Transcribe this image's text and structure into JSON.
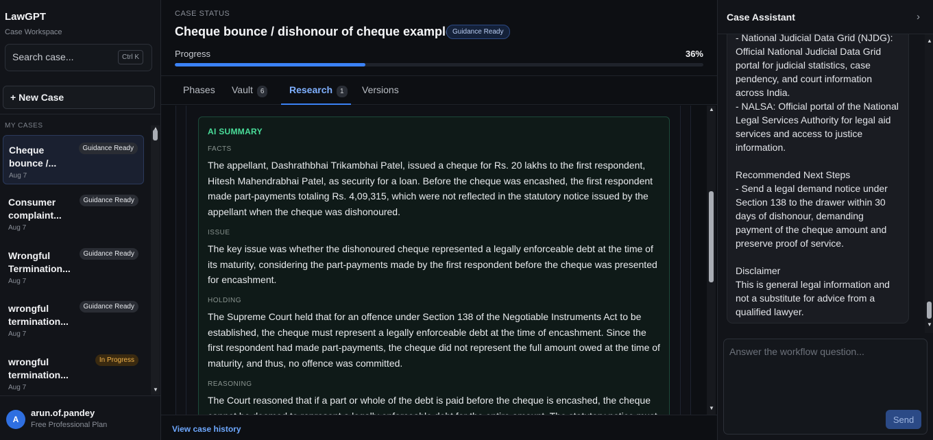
{
  "sidebar": {
    "brand": "LawGPT",
    "brand_sub": "Case Workspace",
    "search_placeholder": "Search case...",
    "search_shortcut": "Ctrl K",
    "new_case_label": "+ New Case",
    "section_label": "MY CASES",
    "cases": [
      {
        "title": "Cheque bounce /...",
        "date": "Aug 7",
        "status": "Guidance Ready"
      },
      {
        "title": "Consumer complaint...",
        "date": "Aug 7",
        "status": "Guidance Ready"
      },
      {
        "title": "Wrongful Termination...",
        "date": "Aug 7",
        "status": "Guidance Ready"
      },
      {
        "title": "wrongful termination...",
        "date": "Aug 7",
        "status": "Guidance Ready"
      },
      {
        "title": "wrongful termination...",
        "date": "Aug 7",
        "status": "In Progress"
      }
    ],
    "user": {
      "initial": "A",
      "name": "arun.of.pandey",
      "plan": "Free Professional Plan"
    }
  },
  "main": {
    "case_status_label": "CASE STATUS",
    "case_title": "Cheque bounce / dishonour of cheque example",
    "case_badge": "Guidance Ready",
    "progress_label": "Progress",
    "progress_percent": "36%",
    "progress_fraction": 0.36,
    "tabs": [
      {
        "label": "Phases",
        "count": ""
      },
      {
        "label": "Vault",
        "count": "6"
      },
      {
        "label": "Research",
        "count": "1"
      },
      {
        "label": "Versions",
        "count": ""
      }
    ],
    "active_tab": "Research",
    "summary": {
      "title": "AI SUMMARY",
      "facts_label": "FACTS",
      "facts_text": "The appellant, Dashrathbhai Trikambhai Patel, issued a cheque for Rs. 20 lakhs to the first respondent, Hitesh Mahendrabhai Patel, as security for a loan. Before the cheque was encashed, the first respondent made part-payments totaling Rs. 4,09,315, which were not reflected in the statutory notice issued by the appellant when the cheque was dishonoured.",
      "issue_label": "ISSUE",
      "issue_text": "The key issue was whether the dishonoured cheque represented a legally enforceable debt at the time of its maturity, considering the part-payments made by the first respondent before the cheque was presented for encashment.",
      "holding_label": "HOLDING",
      "holding_text": "The Supreme Court held that for an offence under Section 138 of the Negotiable Instruments Act to be established, the cheque must represent a legally enforceable debt at the time of encashment. Since the first respondent had made part-payments, the cheque did not represent the full amount owed at the time of maturity, and thus, no offence was committed.",
      "reasoning_label": "REASONING",
      "reasoning_text": "The Court reasoned that if a part or whole of the debt is paid before the cheque is encashed, the cheque cannot be deemed to represent a legally enforceable debt for the entire amount. The statutory notice must"
    },
    "history_link": "View case history"
  },
  "assistant": {
    "title": "Case Assistant",
    "message_lines": [
      "- National Judicial Data Grid (NJDG):",
      "Official National Judicial Data Grid",
      "portal for judicial statistics, case",
      "pendency, and court information",
      "across India.",
      "- NALSA: Official portal of the National",
      "Legal Services Authority for legal aid",
      "services and access to justice",
      "information.",
      "",
      "Recommended Next Steps",
      "- Send a legal demand notice under",
      "Section 138 to the drawer within 30",
      "days of dishonour, demanding",
      "payment of the cheque amount and",
      "preserve proof of service.",
      "",
      "Disclaimer",
      "This is general legal information and",
      "not a substitute for advice from a",
      "qualified lawyer."
    ],
    "answer_placeholder": "Answer the workflow question...",
    "send_label": "Send"
  }
}
